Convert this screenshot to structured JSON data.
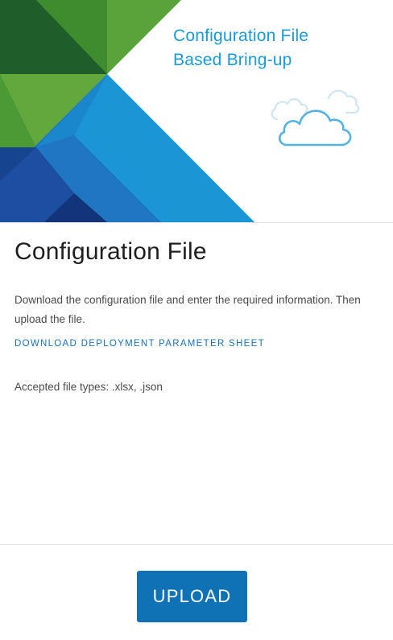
{
  "hero": {
    "title_line1": "Configuration File",
    "title_line2": "Based Bring-up",
    "colors": {
      "green_light": "#62a83c",
      "green_mid": "#3f8c2e",
      "green_dark": "#1f5e2a",
      "blue_light": "#1b9ad6",
      "blue_mid": "#1f77c4",
      "blue_dark": "#17448f",
      "title_color": "#1b9ad6"
    },
    "illustration_icon": "cloud-icon"
  },
  "card": {
    "title": "Configuration File",
    "description": "Download the configuration file and enter the required information. Then upload the file.",
    "download_link": "DOWNLOAD DEPLOYMENT PARAMETER SHEET",
    "accepted_types": "Accepted file types: .xlsx, .json"
  },
  "footer": {
    "upload_label": "UPLOAD",
    "upload_color": "#0e72b5"
  }
}
